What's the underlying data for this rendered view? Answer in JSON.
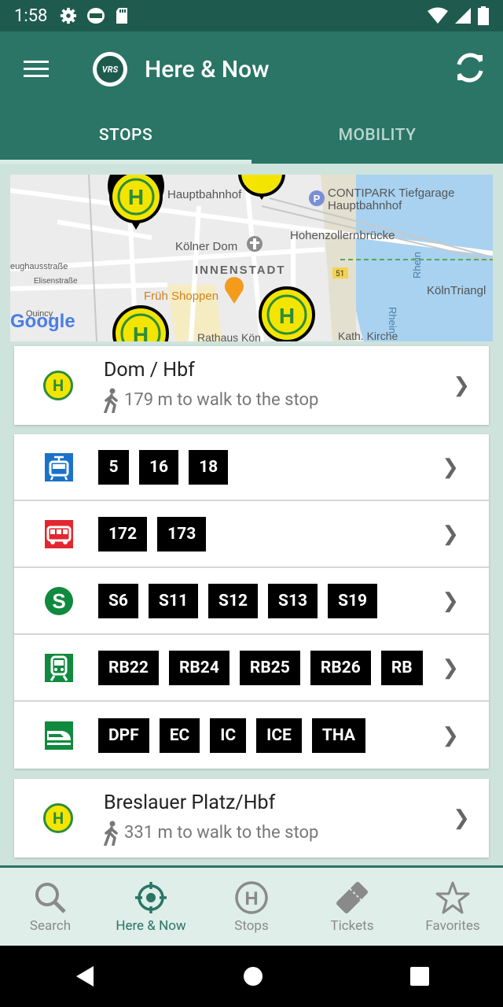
{
  "status_bar": {
    "time": "1:58"
  },
  "app_bar": {
    "title": "Here & Now",
    "logo_text": "VRS"
  },
  "tabs": [
    {
      "label": "STOPS",
      "active": true
    },
    {
      "label": "MOBILITY",
      "active": false
    }
  ],
  "map": {
    "labels": [
      "Hauptbahnhof",
      "CONTIPARK Tiefgarage",
      "Hauptbahnhof",
      "Hohenzollernbrücke",
      "Kölner Dom",
      "INNENSTADT",
      "Früh Shoppen",
      "Rathaus Kön",
      "Kath. Kirche",
      "eughausstraße",
      "Elisenstraße",
      "Rhein",
      "Rhein",
      "KölnTriangl",
      "51",
      "Google",
      "Quincy"
    ]
  },
  "stops": [
    {
      "name": "Dom / Hbf",
      "walk": "179 m to walk to the stop",
      "modes": [
        {
          "icon": "tram-icon",
          "lines": [
            "5",
            "16",
            "18"
          ]
        },
        {
          "icon": "bus-icon",
          "lines": [
            "172",
            "173"
          ]
        },
        {
          "icon": "sbahn-icon",
          "lines": [
            "S6",
            "S11",
            "S12",
            "S13",
            "S19"
          ]
        },
        {
          "icon": "regional-train-icon",
          "lines": [
            "RB22",
            "RB24",
            "RB25",
            "RB26",
            "RB"
          ]
        },
        {
          "icon": "long-distance-train-icon",
          "lines": [
            "DPF",
            "EC",
            "IC",
            "ICE",
            "THA"
          ]
        }
      ]
    },
    {
      "name": "Breslauer Platz/Hbf",
      "walk": "331 m to walk to the stop"
    }
  ],
  "chevron": "❯",
  "bottom_nav": [
    {
      "label": "Search",
      "icon": "search-icon",
      "active": false
    },
    {
      "label": "Here & Now",
      "icon": "crosshair-icon",
      "active": true
    },
    {
      "label": "Stops",
      "icon": "stop-h-icon",
      "active": false
    },
    {
      "label": "Tickets",
      "icon": "ticket-icon",
      "active": false
    },
    {
      "label": "Favorites",
      "icon": "star-icon",
      "active": false
    }
  ]
}
